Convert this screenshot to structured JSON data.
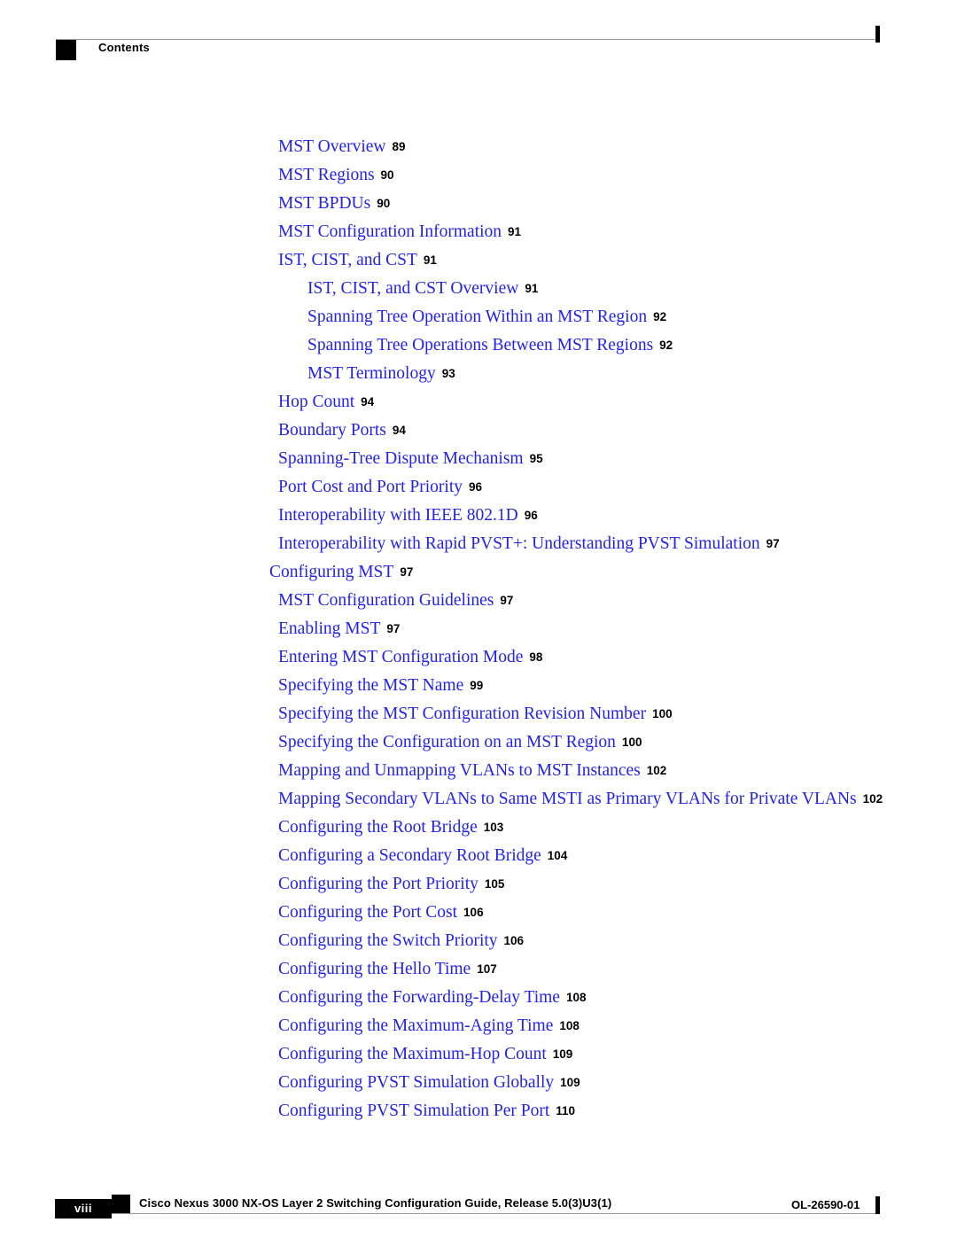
{
  "header": {
    "running_head": "Contents",
    "marker_icon": "black-square-marker",
    "end_bar_icon": "black-vertical-bar"
  },
  "colors": {
    "link": "#2222ee",
    "page_number": "#000000",
    "rule": "#999999",
    "marker": "#000000",
    "page_box_text": "#ffffff"
  },
  "toc": {
    "entries": [
      {
        "title": "MST Overview",
        "page": "89",
        "level": 2
      },
      {
        "title": "MST Regions",
        "page": "90",
        "level": 2
      },
      {
        "title": "MST BPDUs",
        "page": "90",
        "level": 2
      },
      {
        "title": "MST Configuration Information",
        "page": "91",
        "level": 2
      },
      {
        "title": "IST, CIST, and CST",
        "page": "91",
        "level": 2
      },
      {
        "title": "IST, CIST, and CST Overview",
        "page": "91",
        "level": 3
      },
      {
        "title": "Spanning Tree Operation Within an MST Region",
        "page": "92",
        "level": 3
      },
      {
        "title": "Spanning Tree Operations Between MST Regions",
        "page": "92",
        "level": 3
      },
      {
        "title": "MST Terminology",
        "page": "93",
        "level": 3
      },
      {
        "title": "Hop Count",
        "page": "94",
        "level": 2
      },
      {
        "title": "Boundary Ports",
        "page": "94",
        "level": 2
      },
      {
        "title": "Spanning-Tree Dispute Mechanism",
        "page": "95",
        "level": 2
      },
      {
        "title": "Port Cost and Port Priority",
        "page": "96",
        "level": 2
      },
      {
        "title": "Interoperability with IEEE 802.1D",
        "page": "96",
        "level": 2
      },
      {
        "title": "Interoperability with Rapid PVST+: Understanding PVST Simulation",
        "page": "97",
        "level": 2
      },
      {
        "title": "Configuring MST",
        "page": "97",
        "level": 1
      },
      {
        "title": "MST Configuration Guidelines",
        "page": "97",
        "level": 2
      },
      {
        "title": "Enabling MST",
        "page": "97",
        "level": 2
      },
      {
        "title": "Entering MST Configuration Mode",
        "page": "98",
        "level": 2
      },
      {
        "title": "Specifying the MST Name",
        "page": "99",
        "level": 2
      },
      {
        "title": "Specifying the MST Configuration Revision Number",
        "page": "100",
        "level": 2
      },
      {
        "title": "Specifying the Configuration on an MST Region",
        "page": "100",
        "level": 2
      },
      {
        "title": "Mapping and Unmapping VLANs to MST Instances",
        "page": "102",
        "level": 2
      },
      {
        "title": "Mapping Secondary VLANs to Same MSTI as Primary VLANs for Private VLANs",
        "page": "102",
        "level": 2
      },
      {
        "title": "Configuring the Root Bridge",
        "page": "103",
        "level": 2
      },
      {
        "title": "Configuring a Secondary Root Bridge",
        "page": "104",
        "level": 2
      },
      {
        "title": "Configuring the Port Priority",
        "page": "105",
        "level": 2
      },
      {
        "title": "Configuring the Port Cost",
        "page": "106",
        "level": 2
      },
      {
        "title": "Configuring the Switch Priority",
        "page": "106",
        "level": 2
      },
      {
        "title": "Configuring the Hello Time",
        "page": "107",
        "level": 2
      },
      {
        "title": "Configuring the Forwarding-Delay Time",
        "page": "108",
        "level": 2
      },
      {
        "title": "Configuring the Maximum-Aging Time",
        "page": "108",
        "level": 2
      },
      {
        "title": "Configuring the Maximum-Hop Count",
        "page": "109",
        "level": 2
      },
      {
        "title": "Configuring PVST Simulation Globally",
        "page": "109",
        "level": 2
      },
      {
        "title": "Configuring PVST Simulation Per Port",
        "page": "110",
        "level": 2
      }
    ]
  },
  "footer": {
    "document_title": "Cisco Nexus 3000 NX-OS Layer 2 Switching Configuration Guide, Release 5.0(3)U3(1)",
    "page_number": "viii",
    "document_id": "OL-26590-01",
    "marker_icon": "black-square-marker",
    "end_bar_icon": "black-vertical-bar"
  }
}
